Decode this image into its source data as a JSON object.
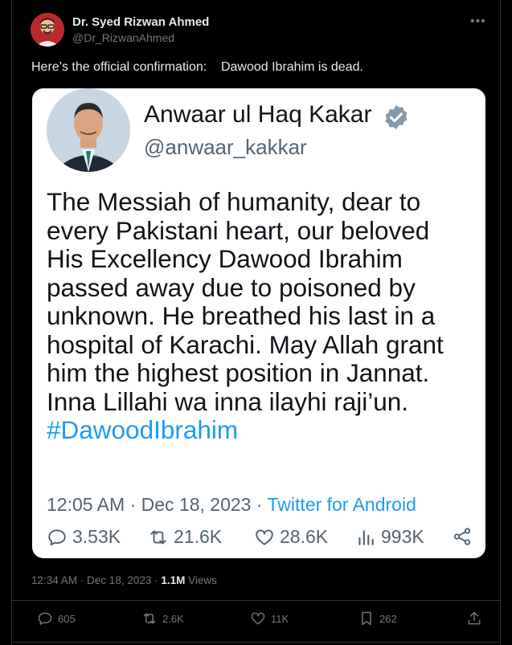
{
  "post": {
    "author_name": "Dr. Syed Rizwan Ahmed",
    "author_handle": "@Dr_RizwanAhmed",
    "more_icon": "ellipsis-icon",
    "text": "Here’s the official confirmation:    Dawood Ibrahim is dead.",
    "time": "12:34 AM",
    "date": "Dec 18, 2023",
    "views_count": "1.1M",
    "views_label": "Views",
    "actions": {
      "replies": "605",
      "reposts": "2.6K",
      "likes": "11K",
      "bookmarks": "262"
    }
  },
  "embedded_card": {
    "name": "Anwaar ul Haq Kakar",
    "handle": "@anwaar_kakkar",
    "body_lines": [
      "The Messiah of humanity, dear to",
      "every Pakistani heart, our beloved",
      "His Excellency Dawood Ibrahim",
      "passed away due to poisoned by",
      "unknown. He breathed his last in a",
      "hospital of Karachi. May Allah grant",
      "him the highest position in Jannat.",
      "Inna Lillahi wa inna ilayhi raji’un."
    ],
    "hashtag": "#DawoodIbrahim",
    "time": "12:05 AM",
    "date": "Dec 18, 2023",
    "source": "Twitter for Android",
    "stats": {
      "replies": "3.53K",
      "retweets": "21.6K",
      "likes": "28.6K",
      "views": "993K"
    }
  },
  "colors": {
    "background": "#000000",
    "accent": "#1d9bf0",
    "muted": "#71767b",
    "card_background": "#ffffff"
  }
}
